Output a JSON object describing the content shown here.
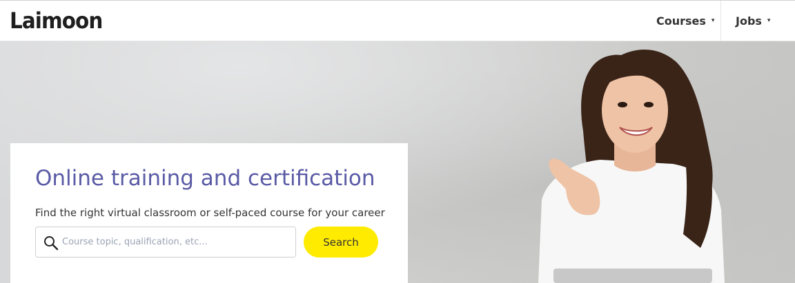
{
  "header": {
    "logo": "Laimoon",
    "nav": [
      {
        "label": "Courses",
        "caret": "▾"
      },
      {
        "label": "Jobs",
        "caret": "▾"
      }
    ]
  },
  "hero": {
    "title": "Online training and certification",
    "subtitle": "Find the right virtual classroom or self-paced course for your career",
    "search": {
      "placeholder": "Course topic, qualification, etc...",
      "value": "",
      "button_label": "Search"
    }
  },
  "colors": {
    "title": "#5a5aa6",
    "search_button": "#ffeb00",
    "placeholder": "#9aa3b3"
  },
  "icons": {
    "search": "search-icon",
    "dropdown": "caret-down-icon"
  }
}
